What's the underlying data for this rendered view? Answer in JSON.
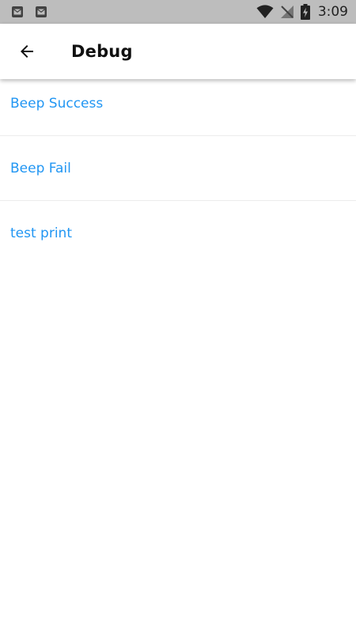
{
  "status_bar": {
    "time": "3:09",
    "icons": [
      "mail-icon",
      "mail-icon",
      "wifi-icon",
      "no-signal-icon",
      "battery-charging-icon"
    ]
  },
  "app_bar": {
    "back_icon": "arrow-back-icon",
    "title": "Debug"
  },
  "debug_items": [
    {
      "label": "Beep Success"
    },
    {
      "label": "Beep Fail"
    },
    {
      "label": "test print"
    }
  ],
  "colors": {
    "status_bar_bg": "#bdbdbd",
    "accent": "#2196f3",
    "title_text": "#111111",
    "divider": "#ececec"
  }
}
